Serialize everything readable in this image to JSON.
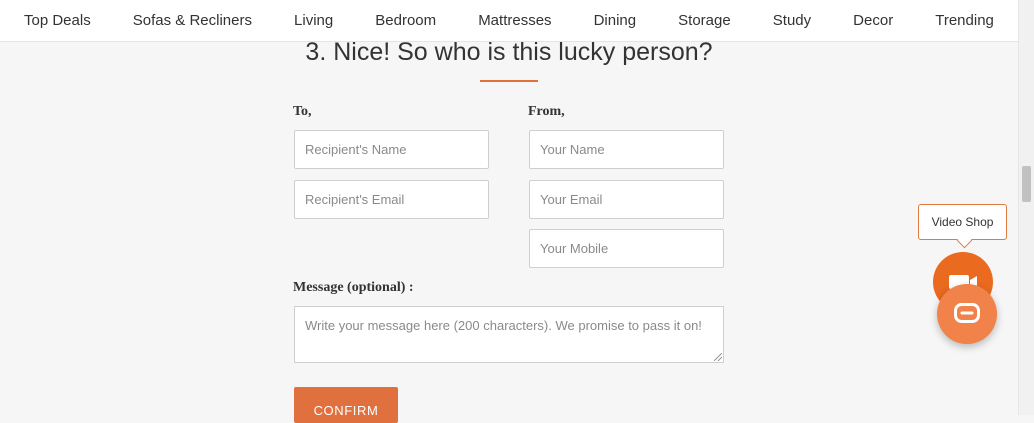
{
  "nav": {
    "items": [
      {
        "label": "Top Deals"
      },
      {
        "label": "Sofas & Recliners"
      },
      {
        "label": "Living"
      },
      {
        "label": "Bedroom"
      },
      {
        "label": "Mattresses"
      },
      {
        "label": "Dining"
      },
      {
        "label": "Storage"
      },
      {
        "label": "Study"
      },
      {
        "label": "Decor"
      },
      {
        "label": "Trending"
      }
    ]
  },
  "section": {
    "title": "3. Nice! So who is this lucky person?"
  },
  "form": {
    "to_label": "To,",
    "from_label": "From,",
    "recipient_name_placeholder": "Recipient's Name",
    "recipient_email_placeholder": "Recipient's Email",
    "your_name_placeholder": "Your Name",
    "your_email_placeholder": "Your Email",
    "your_mobile_placeholder": "Your Mobile",
    "message_label": "Message (optional) :",
    "message_placeholder": "Write your message here (200 characters). We promise to pass it on!",
    "confirm_label": "CONFIRM"
  },
  "widgets": {
    "video_shop_label": "Video Shop",
    "video_icon": "video-camera-icon",
    "chat_icon": "chat-bubble-icon",
    "accent_color": "#e0703d"
  }
}
